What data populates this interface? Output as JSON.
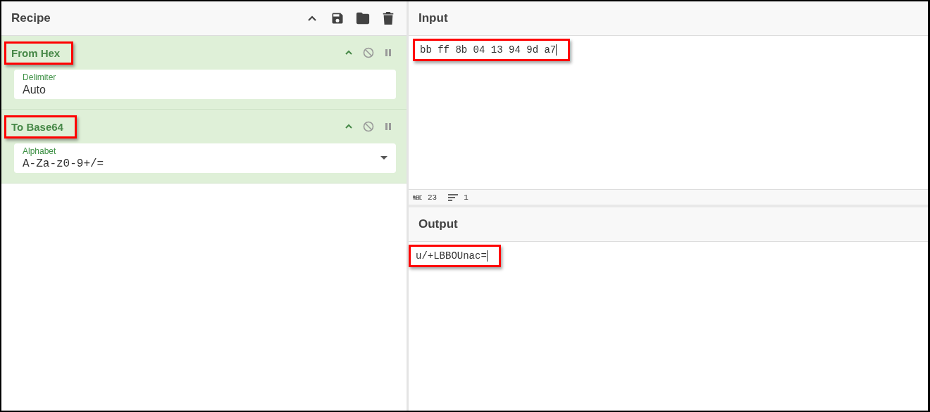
{
  "recipe": {
    "title": "Recipe",
    "operations": [
      {
        "name": "From Hex",
        "highlighted": true,
        "field": {
          "kind": "text",
          "label": "Delimiter",
          "value": "Auto"
        }
      },
      {
        "name": "To Base64",
        "highlighted": true,
        "field": {
          "kind": "dropdown",
          "label": "Alphabet",
          "value": "A-Za-z0-9+/="
        }
      }
    ]
  },
  "input": {
    "title": "Input",
    "value": "bb ff 8b 04 13 94 9d a7",
    "highlighted": true,
    "status": {
      "length": "23",
      "lines": "1"
    }
  },
  "output": {
    "title": "Output",
    "value": "u/+LBBOUnac=",
    "highlighted": true
  }
}
